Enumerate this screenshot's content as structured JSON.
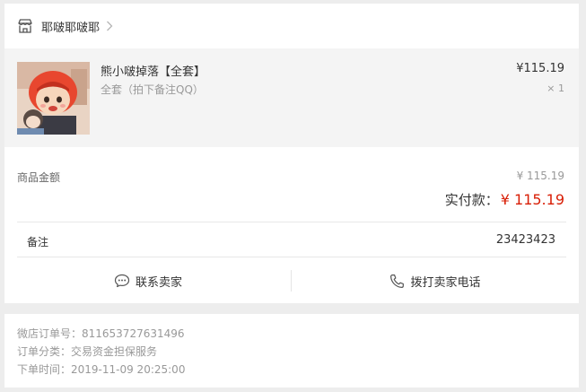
{
  "store": {
    "name": "耶啵耶啵耶"
  },
  "product": {
    "title": "熊小啵掉落【全套】",
    "sku": "全套（拍下备注QQ）",
    "price": "¥115.19",
    "quantity": "× 1"
  },
  "summary": {
    "goods_amount_label": "商品金额",
    "goods_amount_value": "¥ 115.19",
    "actual_label": "实付款：",
    "actual_value": "¥ 115.19"
  },
  "remark": {
    "label": "备注",
    "value": "23423423"
  },
  "actions": {
    "contact_label": "联系卖家",
    "call_label": "拨打卖家电话"
  },
  "order_info": {
    "order_number": "微店订单号：811653727631496",
    "order_category": "订单分类：交易资金担保服务",
    "order_time": "下单时间：2019-11-09 20:25:00"
  },
  "colors": {
    "price_red": "#d81e06",
    "muted_gray": "#999999",
    "panel_gray": "#f4f4f4"
  },
  "icons": [
    "shop-icon",
    "chevron-right-icon",
    "chat-bubble-icon",
    "phone-icon"
  ]
}
